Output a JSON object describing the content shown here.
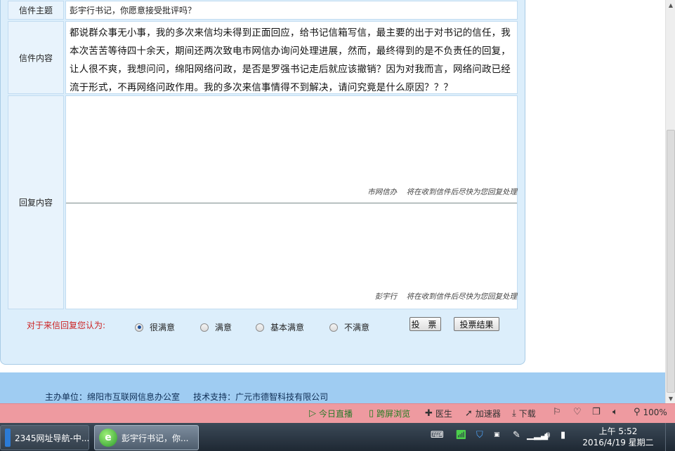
{
  "letter": {
    "subject_label": "信件主题",
    "subject_value": "彭宇行书记，你愿意接受批评吗？",
    "content_label": "信件内容",
    "content_value": "都说群众事无小事，我的多次来信均未得到正面回应，给书记信箱写信，最主要的出于对书记的信任，我本次苦苦等待四十余天，期间还两次致电市网信办询问处理进展，然而，最终得到的是不负责任的回复，让人很不爽，我想问问，绵阳网络问政，是否是罗强书记走后就应该撤销？因为对我而言，网络问政已经流于形式，不再网络问政作用。我的多次来信事情得不到解决，请问究竟是什么原因？？？",
    "reply_label": "回复内容",
    "replies": [
      {
        "signature": "市网信办    将在收到信件后尽快为您回复处理"
      },
      {
        "signature": "彭宇行    将在收到信件后尽快为您回复处理"
      }
    ]
  },
  "vote": {
    "prompt": "对于来信回复您认为:",
    "options": [
      {
        "label": "很满意",
        "checked": true
      },
      {
        "label": "满意",
        "checked": false
      },
      {
        "label": "基本满意",
        "checked": false
      },
      {
        "label": "不满意",
        "checked": false
      }
    ],
    "vote_button": "投 票",
    "result_button": "投票结果"
  },
  "footer": {
    "text": "主办单位：绵阳市互联网信息办公室     技术支持：广元市德智科技有限公司"
  },
  "statusbar": {
    "live": "今日直播",
    "cross_screen": "跨屏浏览",
    "doctor": "医生",
    "accelerator": "加速器",
    "download": "下载",
    "zoom": "100%"
  },
  "taskbar": {
    "task1": "2345网址导航-中...",
    "task2": "彭宇行书记，你...",
    "task1_icon": "browser-2345-icon",
    "task2_icon": "browser-green-e-icon"
  },
  "clock": {
    "time": "上午 5:52",
    "date": "2016/4/19 星期二"
  },
  "colors": {
    "panel_bg": "#dceefb",
    "footer_bg": "#9fccf2",
    "statusbar_bg": "#ee9aa0",
    "vote_prompt": "#cc2222"
  }
}
